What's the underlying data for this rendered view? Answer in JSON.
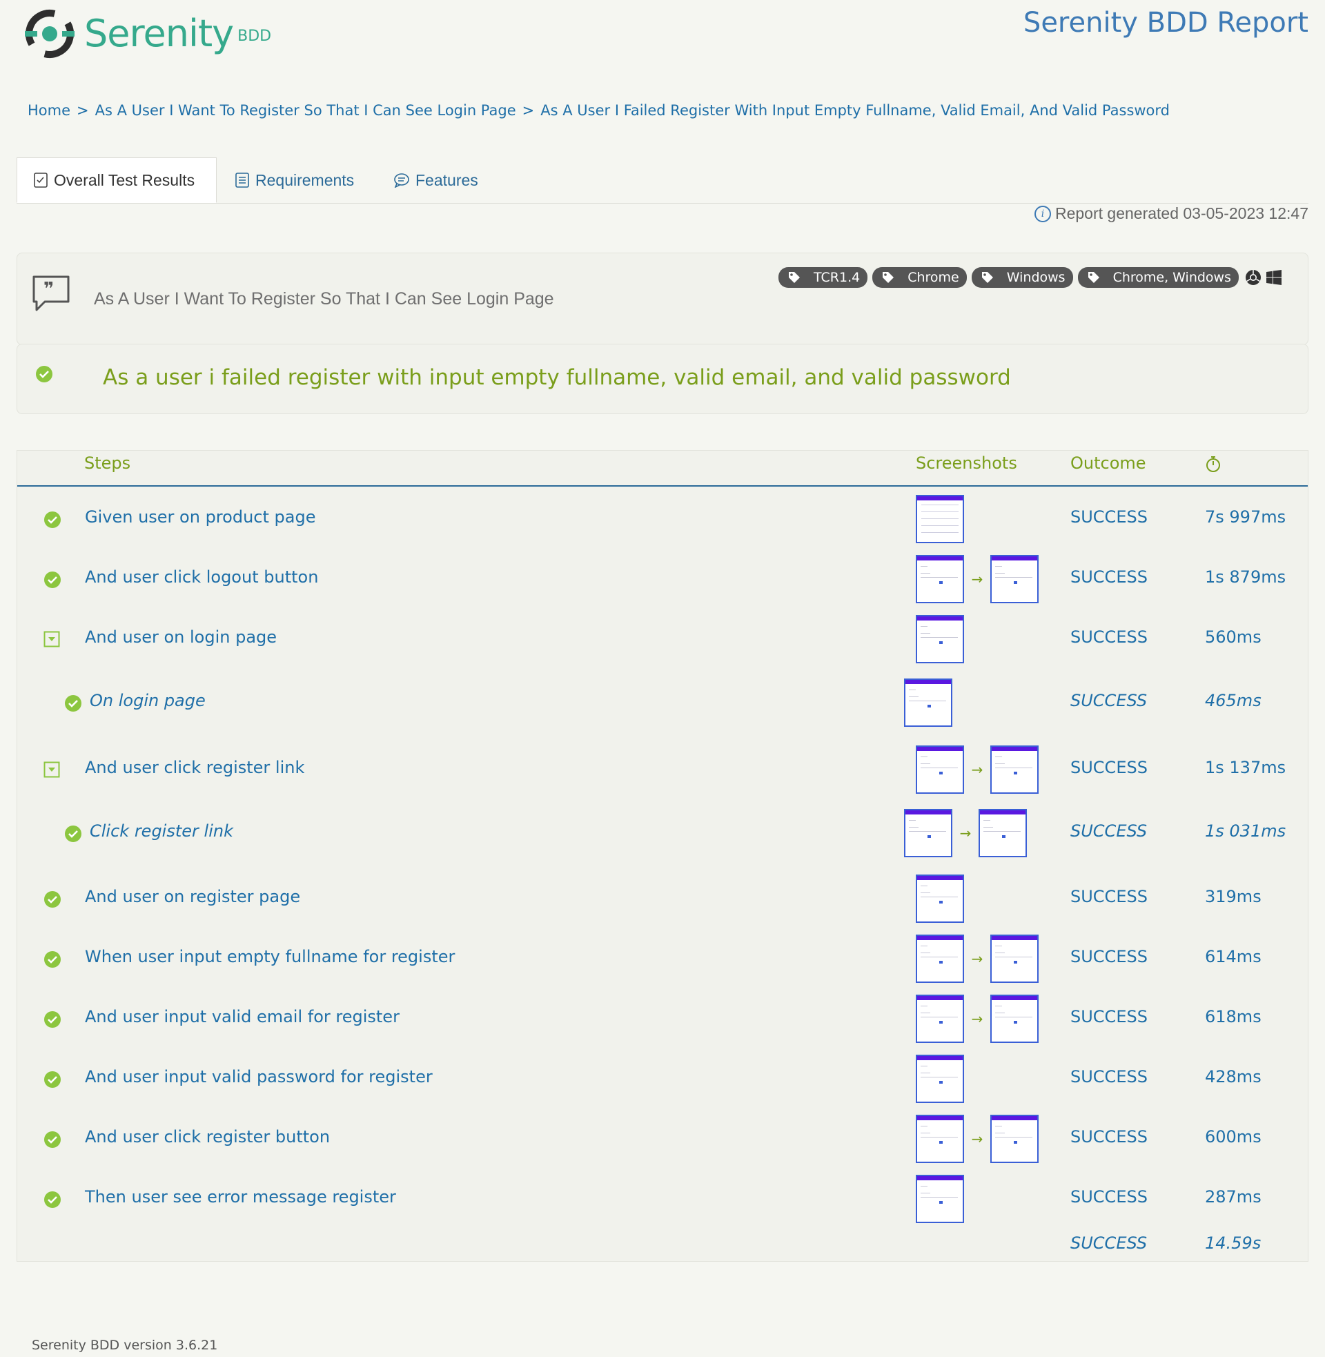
{
  "header": {
    "logo_word": "Serenity",
    "logo_suffix": "BDD",
    "report_title": "Serenity BDD Report"
  },
  "breadcrumb": {
    "items": [
      "Home",
      "As A User I Want To Register So That I Can See Login Page",
      "As A User I Failed Register With Input Empty Fullname, Valid Email, And Valid Password"
    ],
    "separator": ">"
  },
  "tabs": [
    {
      "label": "Overall Test Results",
      "icon": "checklist-icon",
      "active": true
    },
    {
      "label": "Requirements",
      "icon": "document-list-icon",
      "active": false
    },
    {
      "label": "Features",
      "icon": "chat-bubble-icon",
      "active": false
    }
  ],
  "report_generated": "Report generated 03-05-2023 12:47",
  "feature": {
    "name": "As A User I Want To Register So That I Can See Login Page",
    "tags": [
      "TCR1.4",
      "Chrome",
      "Windows",
      "Chrome, Windows"
    ],
    "platform_icons": [
      "chrome-icon",
      "windows-icon"
    ]
  },
  "scenario": {
    "title": "As a user i failed register with input empty fullname, valid email, and valid password",
    "status": "success"
  },
  "steps_table": {
    "headers": {
      "steps": "Steps",
      "screenshots": "Screenshots",
      "outcome": "Outcome",
      "duration_icon": "stopwatch-icon"
    },
    "rows": [
      {
        "label": "Given user on product page",
        "outcome": "SUCCESS",
        "duration": "7s 997ms",
        "screenshots": 1,
        "icon": "success-check-icon",
        "child": false
      },
      {
        "label": "And user click logout button",
        "outcome": "SUCCESS",
        "duration": "1s 879ms",
        "screenshots": 2,
        "icon": "success-check-icon",
        "child": false
      },
      {
        "label": "And user on login page",
        "outcome": "SUCCESS",
        "duration": "560ms",
        "screenshots": 1,
        "icon": "expand-toggle-icon",
        "child": false
      },
      {
        "label": "On login page",
        "outcome": "SUCCESS",
        "duration": "465ms",
        "screenshots": 1,
        "icon": "success-check-icon",
        "child": true
      },
      {
        "label": "And user click register link",
        "outcome": "SUCCESS",
        "duration": "1s 137ms",
        "screenshots": 2,
        "icon": "expand-toggle-icon",
        "child": false
      },
      {
        "label": "Click register link",
        "outcome": "SUCCESS",
        "duration": "1s 031ms",
        "screenshots": 2,
        "icon": "success-check-icon",
        "child": true
      },
      {
        "label": "And user on register page",
        "outcome": "SUCCESS",
        "duration": "319ms",
        "screenshots": 1,
        "icon": "success-check-icon",
        "child": false
      },
      {
        "label": "When user input empty fullname for register",
        "outcome": "SUCCESS",
        "duration": "614ms",
        "screenshots": 2,
        "icon": "success-check-icon",
        "child": false
      },
      {
        "label": "And user input valid email for register",
        "outcome": "SUCCESS",
        "duration": "618ms",
        "screenshots": 2,
        "icon": "success-check-icon",
        "child": false
      },
      {
        "label": "And user input valid password for register",
        "outcome": "SUCCESS",
        "duration": "428ms",
        "screenshots": 1,
        "icon": "success-check-icon",
        "child": false
      },
      {
        "label": "And user click register button",
        "outcome": "SUCCESS",
        "duration": "600ms",
        "screenshots": 2,
        "icon": "success-check-icon",
        "child": false
      },
      {
        "label": "Then user see error message register",
        "outcome": "SUCCESS",
        "duration": "287ms",
        "screenshots": 1,
        "icon": "success-check-icon",
        "child": false
      }
    ],
    "total": {
      "outcome": "SUCCESS",
      "duration": "14.59s"
    }
  },
  "footer": {
    "version": "Serenity BDD version 3.6.21"
  },
  "colors": {
    "accent_green": "#7a9e1b",
    "link_blue": "#1f6fa8",
    "title_blue": "#3e7ab5",
    "check_green": "#8cc63f"
  }
}
